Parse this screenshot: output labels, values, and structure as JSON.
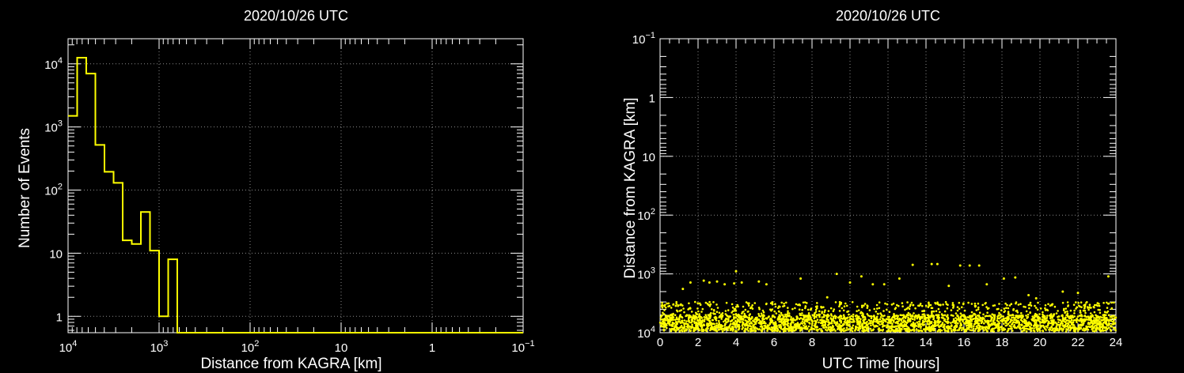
{
  "colors": {
    "background": "#000000",
    "foreground": "#ffffff",
    "series": "#ffff00",
    "grid": "#8a8a8a"
  },
  "chart_data": [
    {
      "type": "histogram",
      "title": "2020/10/26 UTC",
      "xlabel": "Distance from KAGRA [km]",
      "ylabel": "Number of Events",
      "x_scale": "log",
      "x_reversed": true,
      "xlim": [
        10000,
        0.1
      ],
      "y_scale": "log",
      "ylim": [
        0.55,
        25000
      ],
      "grid": true,
      "x_ticks": [
        {
          "value": 10000,
          "base": "10",
          "exp": "4"
        },
        {
          "value": 1000,
          "base": "10",
          "exp": "3"
        },
        {
          "value": 100,
          "base": "10",
          "exp": "2"
        },
        {
          "value": 10,
          "base": "10",
          "exp": ""
        },
        {
          "value": 1,
          "base": "1",
          "exp": ""
        },
        {
          "value": 0.1,
          "base": "10",
          "exp": "−1"
        }
      ],
      "y_ticks": [
        {
          "value": 1,
          "base": "1",
          "exp": ""
        },
        {
          "value": 10,
          "base": "10",
          "exp": ""
        },
        {
          "value": 100,
          "base": "10",
          "exp": "2"
        },
        {
          "value": 1000,
          "base": "10",
          "exp": "3"
        },
        {
          "value": 10000,
          "base": "10",
          "exp": "4"
        }
      ],
      "bins": [
        {
          "x_from": 10000,
          "x_to": 7943,
          "count": 1500
        },
        {
          "x_from": 7943,
          "x_to": 6310,
          "count": 12500
        },
        {
          "x_from": 6310,
          "x_to": 5012,
          "count": 7000
        },
        {
          "x_from": 5012,
          "x_to": 3981,
          "count": 520
        },
        {
          "x_from": 3981,
          "x_to": 3162,
          "count": 195
        },
        {
          "x_from": 3162,
          "x_to": 2512,
          "count": 130
        },
        {
          "x_from": 2512,
          "x_to": 1995,
          "count": 16
        },
        {
          "x_from": 1995,
          "x_to": 1585,
          "count": 14
        },
        {
          "x_from": 1585,
          "x_to": 1259,
          "count": 45
        },
        {
          "x_from": 1259,
          "x_to": 1000,
          "count": 11
        },
        {
          "x_from": 1000,
          "x_to": 794,
          "count": 1
        },
        {
          "x_from": 794,
          "x_to": 631,
          "count": 8
        },
        {
          "x_from": 631,
          "x_to": 0.1,
          "count": 0
        }
      ]
    },
    {
      "type": "scatter",
      "title": "2020/10/26 UTC",
      "xlabel": "UTC Time [hours]",
      "ylabel": "Distance from KAGRA [km]",
      "xlim": [
        0,
        24
      ],
      "y_scale": "log",
      "y_reversed": true,
      "ylim": [
        0.1,
        10000
      ],
      "grid": true,
      "x_ticks": [
        "0",
        "2",
        "4",
        "6",
        "8",
        "10",
        "12",
        "14",
        "16",
        "18",
        "20",
        "22",
        "24"
      ],
      "y_ticks": [
        {
          "value": 0.1,
          "base": "10",
          "exp": "−1"
        },
        {
          "value": 1,
          "base": "1",
          "exp": ""
        },
        {
          "value": 10,
          "base": "10",
          "exp": ""
        },
        {
          "value": 100,
          "base": "10",
          "exp": "2"
        },
        {
          "value": 1000,
          "base": "10",
          "exp": "3"
        },
        {
          "value": 10000,
          "base": "10",
          "exp": "4"
        }
      ],
      "points_summary": {
        "dense_band_km": [
          5000,
          9500
        ],
        "upper_band_km": [
          3000,
          5000
        ],
        "sparse_points": [
          {
            "x": 1.2,
            "y": 1800
          },
          {
            "x": 1.6,
            "y": 1400
          },
          {
            "x": 2.3,
            "y": 1300
          },
          {
            "x": 2.6,
            "y": 1400
          },
          {
            "x": 3.0,
            "y": 1350
          },
          {
            "x": 3.4,
            "y": 1500
          },
          {
            "x": 3.9,
            "y": 1450
          },
          {
            "x": 4.0,
            "y": 900
          },
          {
            "x": 4.3,
            "y": 1400
          },
          {
            "x": 5.2,
            "y": 1350
          },
          {
            "x": 5.6,
            "y": 1500
          },
          {
            "x": 7.4,
            "y": 1200
          },
          {
            "x": 8.8,
            "y": 2500
          },
          {
            "x": 9.3,
            "y": 1000
          },
          {
            "x": 10.0,
            "y": 1400
          },
          {
            "x": 10.6,
            "y": 1100
          },
          {
            "x": 11.2,
            "y": 1500
          },
          {
            "x": 11.8,
            "y": 1500
          },
          {
            "x": 12.6,
            "y": 1200
          },
          {
            "x": 13.3,
            "y": 700
          },
          {
            "x": 14.3,
            "y": 680
          },
          {
            "x": 14.6,
            "y": 680
          },
          {
            "x": 15.2,
            "y": 1600
          },
          {
            "x": 15.8,
            "y": 720
          },
          {
            "x": 16.3,
            "y": 720
          },
          {
            "x": 16.8,
            "y": 720
          },
          {
            "x": 17.2,
            "y": 1500
          },
          {
            "x": 18.1,
            "y": 1200
          },
          {
            "x": 18.7,
            "y": 1150
          },
          {
            "x": 19.4,
            "y": 2300
          },
          {
            "x": 19.8,
            "y": 2600
          },
          {
            "x": 21.2,
            "y": 2000
          },
          {
            "x": 23.6,
            "y": 1100
          },
          {
            "x": 22.0,
            "y": 2100
          }
        ]
      }
    }
  ]
}
